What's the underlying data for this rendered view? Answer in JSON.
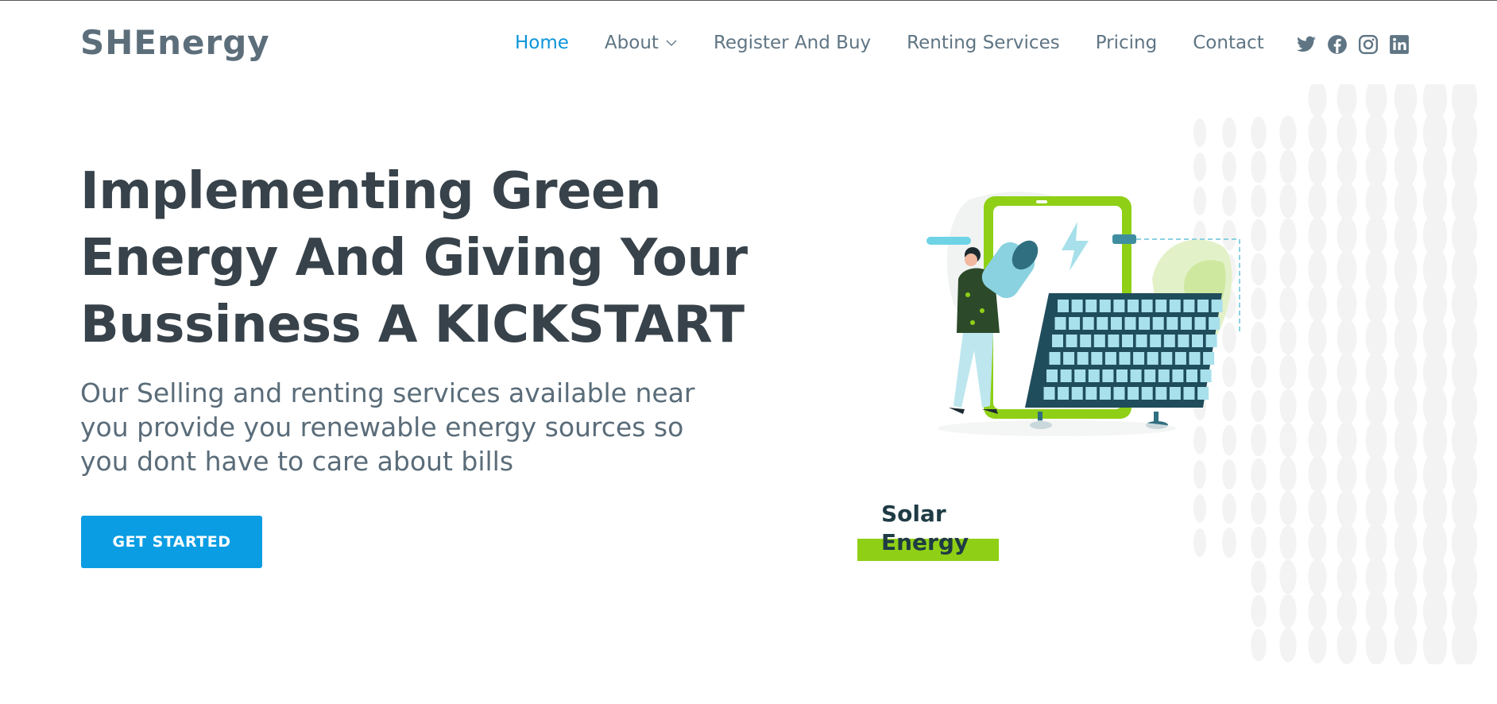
{
  "header": {
    "logo": "SHEnergy",
    "nav": [
      {
        "label": "Home",
        "active": true
      },
      {
        "label": "About",
        "dropdown": true
      },
      {
        "label": "Register And Buy"
      },
      {
        "label": "Renting Services"
      },
      {
        "label": "Pricing"
      },
      {
        "label": "Contact"
      }
    ],
    "social_icons": [
      "twitter-icon",
      "facebook-icon",
      "instagram-icon",
      "linkedin-icon"
    ]
  },
  "hero": {
    "title": "Implementing Green Energy And Giving Your Bussiness A KICKSTART",
    "subtitle": "Our Selling and renting services available near you provide you renewable energy sources so you dont have to care about bills",
    "cta_label": "GET STARTED",
    "illustration_label": "Solar\nEnergy"
  },
  "colors": {
    "accent": "#0b9de3",
    "heading": "#37424a",
    "text": "#5a6c79",
    "solar_green": "#8fd016",
    "panel": "#1f4d5c"
  }
}
